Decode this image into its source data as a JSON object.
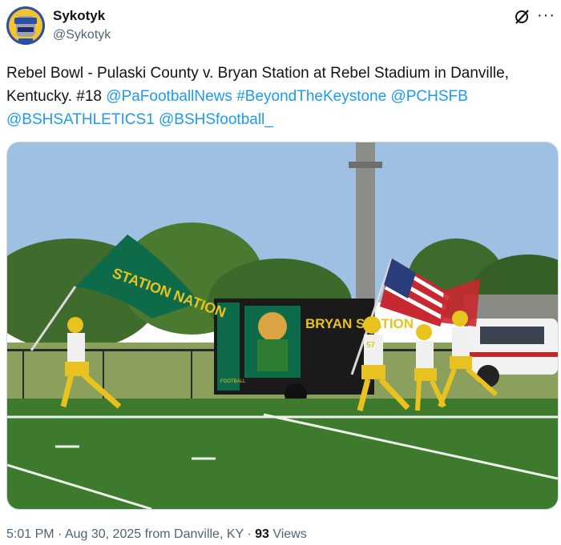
{
  "author": {
    "display_name": "Sykotyk",
    "handle": "@Sykotyk",
    "avatar_label": "SYKOTYK"
  },
  "header_icons": [
    "grok-icon",
    "more-options-icon"
  ],
  "tweet": {
    "text_line1": "Rebel Bowl - Pulaski County v. Bryan Station at Rebel Stadium in Danville, Kentucky. #18 ",
    "mention1": "@PaFootballNews",
    "hashtag": "#BeyondTheKeystone",
    "mention2": "@PCHSFB",
    "mention3": "@BSHSATHLETICS1",
    "mention4": "@BSHSfootball_"
  },
  "photo": {
    "flag_text": "STATION NATION",
    "trailer_text": "BRYAN STATION",
    "trailer_side_text": "FOOTBALL",
    "jersey_number_1": "57"
  },
  "meta": {
    "time": "5:01 PM",
    "sep1": " · ",
    "date": "Aug 30, 2025",
    "from": " from Danville, KY",
    "sep2": " · ",
    "views_count": "93",
    "views_label": " Views"
  },
  "colors": {
    "link": "#1d9bf0",
    "secondary": "#536471",
    "team_green": "#0e6b4a",
    "team_gold": "#e8c21e"
  }
}
